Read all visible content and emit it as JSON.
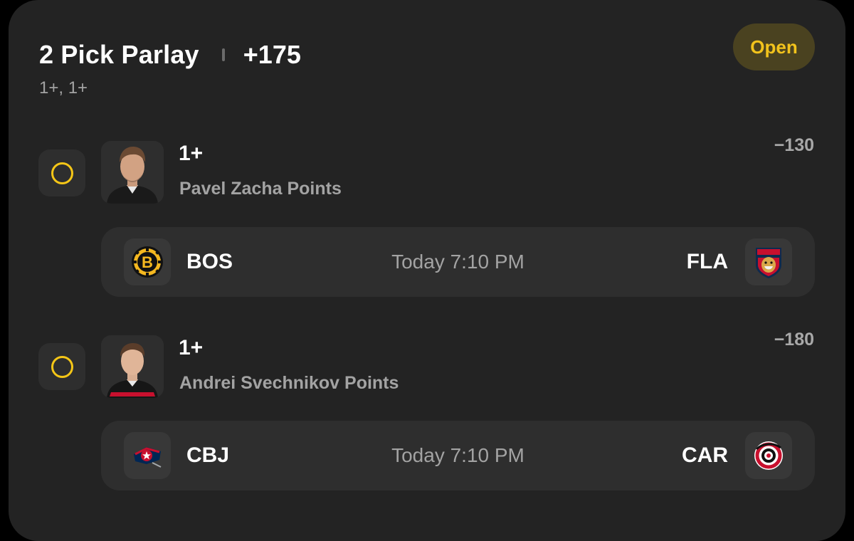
{
  "parlay": {
    "title": "2 Pick Parlay",
    "odds": "+175",
    "summary": "1+, 1+",
    "status": "Open"
  },
  "legs": [
    {
      "line": "1+",
      "prop": "Pavel Zacha Points",
      "odds": "−130",
      "away_team": "BOS",
      "home_team": "FLA",
      "time": "Today 7:10 PM"
    },
    {
      "line": "1+",
      "prop": "Andrei Svechnikov Points",
      "odds": "−180",
      "away_team": "CBJ",
      "home_team": "CAR",
      "time": "Today 7:10 PM"
    }
  ],
  "colors": {
    "accent": "#f5c617",
    "card": "#232323",
    "surface": "#2e2e2e"
  },
  "icons": {
    "bos": "bruins-logo-icon",
    "fla": "panthers-logo-icon",
    "cbj": "blue-jackets-logo-icon",
    "car": "hurricanes-logo-icon"
  }
}
